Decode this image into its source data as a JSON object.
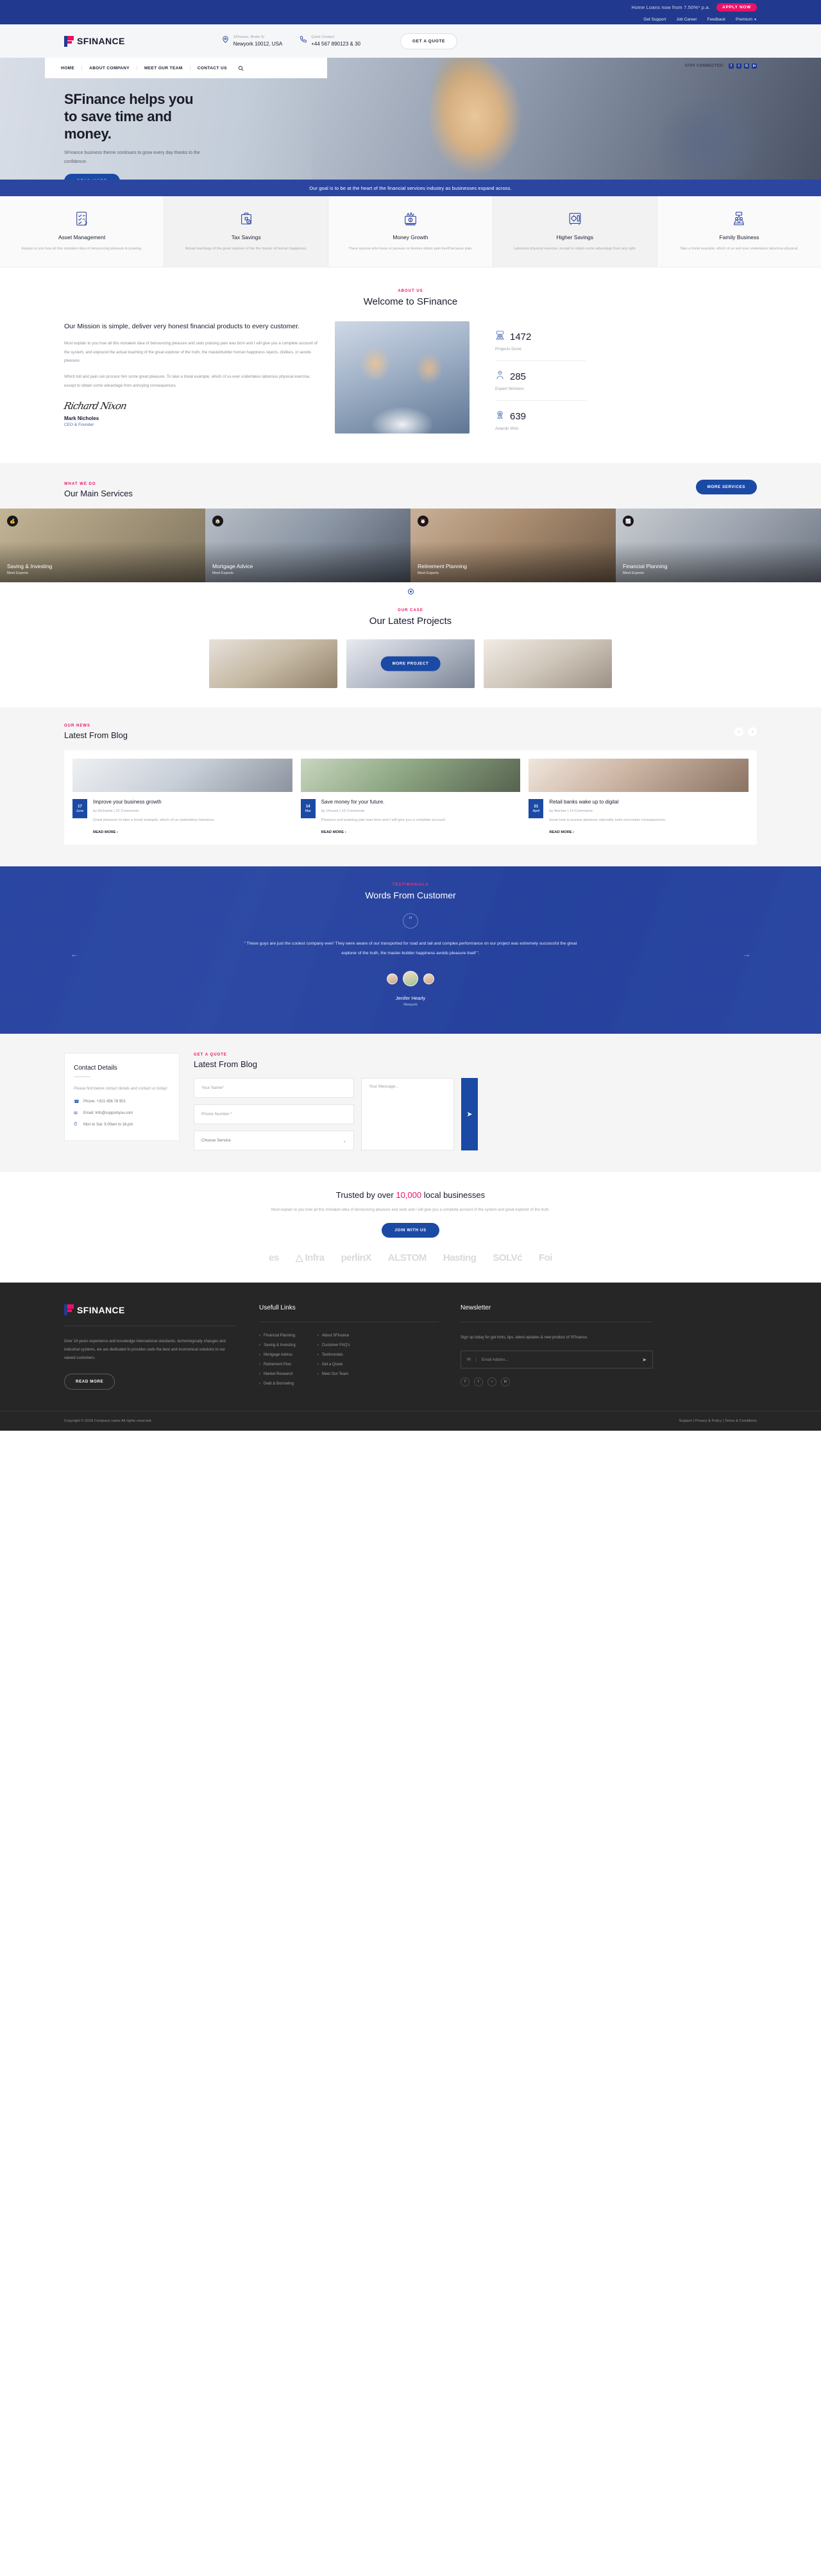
{
  "promo": {
    "text": "Home Loans now from 7.50%* p.a.",
    "button": "APPLY NOW"
  },
  "utility": {
    "links": [
      "Get Support",
      "Job Career",
      "Feedback",
      "Premium"
    ]
  },
  "header": {
    "brand": "SFINANCE",
    "address_label": "SFinance, Broke St",
    "address_value": "Newyork 10012, USA",
    "contact_label": "Quick Contact:",
    "contact_value": "+44 567 890123 & 30",
    "quote_button": "GET A QUOTE"
  },
  "nav": {
    "items": [
      "HOME",
      "ABOUT COMPANY",
      "MEET OUR TEAM",
      "CONTACT US"
    ],
    "search_icon": "search-icon",
    "social_label": "STAY CONNECTED:",
    "socials": [
      "f",
      "t",
      "G",
      "in"
    ]
  },
  "hero": {
    "title_line1": "SFinance helps you",
    "title_line2": "to save time and",
    "title_line3": "money.",
    "subtitle": "SFinance business theme continues to grow every day thanks to the confidence.",
    "button": "READ MORE"
  },
  "goal_band": {
    "text": "Our goal is to be at the heart of the financial services industry as businesses expand across."
  },
  "features": [
    {
      "icon": "clipboard-check-icon",
      "title": "Asset Management",
      "desc": "Explain to you how all this mistaken idea of denouncing pleasure & praising."
    },
    {
      "icon": "briefcase-percent-icon",
      "title": "Tax Savings",
      "desc": "Actual teachings of the great explorer of the the master of human happiness."
    },
    {
      "icon": "money-growth-icon",
      "title": "Money Growth",
      "desc": "There anyone who loves or pursues or desires obtain pain itself because pain."
    },
    {
      "icon": "safe-vault-icon",
      "title": "Higher Savings",
      "desc": "Laborious physical exercise, except to obtain some advantage from any right."
    },
    {
      "icon": "family-icon",
      "title": "Family Business",
      "desc": "Take a trivial example, which of us sed ever undertakes laborious physical."
    }
  ],
  "about": {
    "eyebrow": "ABOUT US",
    "title": "Welcome to SFinance",
    "heading": "Our Mission is simple, deliver very honest financial products to every customer.",
    "paragraph1": "Must explain to you how all this mistaken idea of denouncing pleasure and seds praising pain was born and I will give you a complete account of the system, and expound the actual teaching of the great explorer of the truth, the masterbuilder human happiness rejects, dislikes, or avoids pleasure.",
    "paragraph2": "Which toil and pain can procure him some great pleasure. To take a trivial example, which of us ever undertakes laborious physical exercise, except to obtain some advantage from annoying consequences.",
    "signature": "Richard Nixon",
    "author_name": "Mark Nicholes",
    "author_role": "CEO & Founder",
    "stats": [
      {
        "icon": "team-board-icon",
        "value": "1472",
        "label": "Projects Done"
      },
      {
        "icon": "worker-icon",
        "value": "285",
        "label": "Expert Workers"
      },
      {
        "icon": "award-icon",
        "value": "639",
        "label": "Awards Won"
      }
    ]
  },
  "services": {
    "eyebrow": "WHAT WE DO",
    "title": "Our Main Services",
    "button": "MORE SERVICES",
    "cards": [
      {
        "icon": "piggy-icon",
        "title": "Saving & Investing",
        "sub": "Meet Experts"
      },
      {
        "icon": "home-icon",
        "title": "Mortgage Advice",
        "sub": "Meet Experts"
      },
      {
        "icon": "clock-icon",
        "title": "Retirement Planning",
        "sub": "Meet Experts"
      },
      {
        "icon": "chart-icon",
        "title": "Financial Planning",
        "sub": "Meet Experts"
      }
    ]
  },
  "projects": {
    "eyebrow": "OUR CASE",
    "title": "Our Latest Projects",
    "button": "MORE PROJECT"
  },
  "blog": {
    "eyebrow": "OUR NEWS",
    "title": "Latest From Blog",
    "prev_icon": "chevron-left-icon",
    "next_icon": "chevron-right-icon",
    "posts": [
      {
        "day": "17",
        "month": "June",
        "title": "Improve your business growth",
        "meta": "by Richards | 22 Comments",
        "excerpt": "Great pleasure to take a trivial example, which of us undertakes laborious.",
        "more": "READ MORE ›"
      },
      {
        "day": "14",
        "month": "Mar",
        "title": "Save money for your future.",
        "meta": "by Vincent | 16 Comments",
        "excerpt": "Pleasure and praising pain was born and I will give you a complete account.",
        "more": "READ MORE ›"
      },
      {
        "day": "21",
        "month": "April",
        "title": "Retail banks wake up to digital",
        "meta": "by fletcher | 14 Comments",
        "excerpt": "know how to pursue pleasure rationally seds encounter consequences.",
        "more": "READ MORE ›"
      }
    ]
  },
  "testimonials": {
    "eyebrow": "TESTIMONIALS",
    "title": "Words From Customer",
    "quote": "“ These guys are just the coolest company ever! They were aware of our transported for road and tail and complex.performance on our project was extremely successful the great explorer of the truth, the master-builder happiness avoids pleasure itself ”.",
    "name": "Jenifer Hearly",
    "location": "Newyork",
    "prev_icon": "arrow-left-icon",
    "next_icon": "arrow-right-icon"
  },
  "contact": {
    "details_title": "Contact Details",
    "details_text": "Please find below contact details and contact us today!",
    "phone": "Phone: +321 456 78 901",
    "email": "Email: Info@supportyou.com",
    "hours": "Mon to Sat: 9.00am to 16.pm",
    "eyebrow": "GET A QUOTE",
    "title": "Latest From Blog",
    "name_placeholder": "Your Name*",
    "phone_placeholder": "Phone Number *",
    "service_placeholder": "Choose Service",
    "message_placeholder": "Your Message...",
    "send_icon": "send-icon"
  },
  "trusted": {
    "title_pre": "Trusted by over ",
    "title_accent": "10,000",
    "title_post": " local businesses",
    "desc": "Must explain to you how all this mistaken idea of denouncing pleasure and seds and I will give you a complete account of the system and great explorer of the truth.",
    "button": "JOIN WITH US",
    "brands": [
      "es",
      "△ Infra",
      "perlinX",
      "ALSTOM",
      "Hasting",
      "SOLVć",
      "Foi"
    ]
  },
  "footer": {
    "brand": "SFINANCE",
    "about": "Over 24 years experience and knowledge international standards, technologically changes and industrial systems, we are dedicated to provides seds the best and economical solutions to our valued customers.",
    "read_more": "READ MORE",
    "links_title": "Usefull Links",
    "links_col1": [
      "Financial Planning",
      "Saving & Investing",
      "Mortgage Advice",
      "Retirement Plan",
      "Market Research",
      "Debt & Borrowing"
    ],
    "links_col2": [
      "About SFinance",
      "Customer FAQ's",
      "Testimonials",
      "Get a Quote",
      "Meet Our Team"
    ],
    "newsletter_title": "Newsletter",
    "newsletter_text": "Sign up today for get hints, tips, latest updates & new product of SFinance.",
    "email_placeholder": "Email Addres...",
    "socials": [
      "f",
      "t",
      "○",
      "in"
    ],
    "copyright": "Copyright © 2018 Company name All rights reserved.",
    "bottom_links": [
      "Support",
      "Privacy & Policy",
      "Terms & Conditions"
    ]
  }
}
